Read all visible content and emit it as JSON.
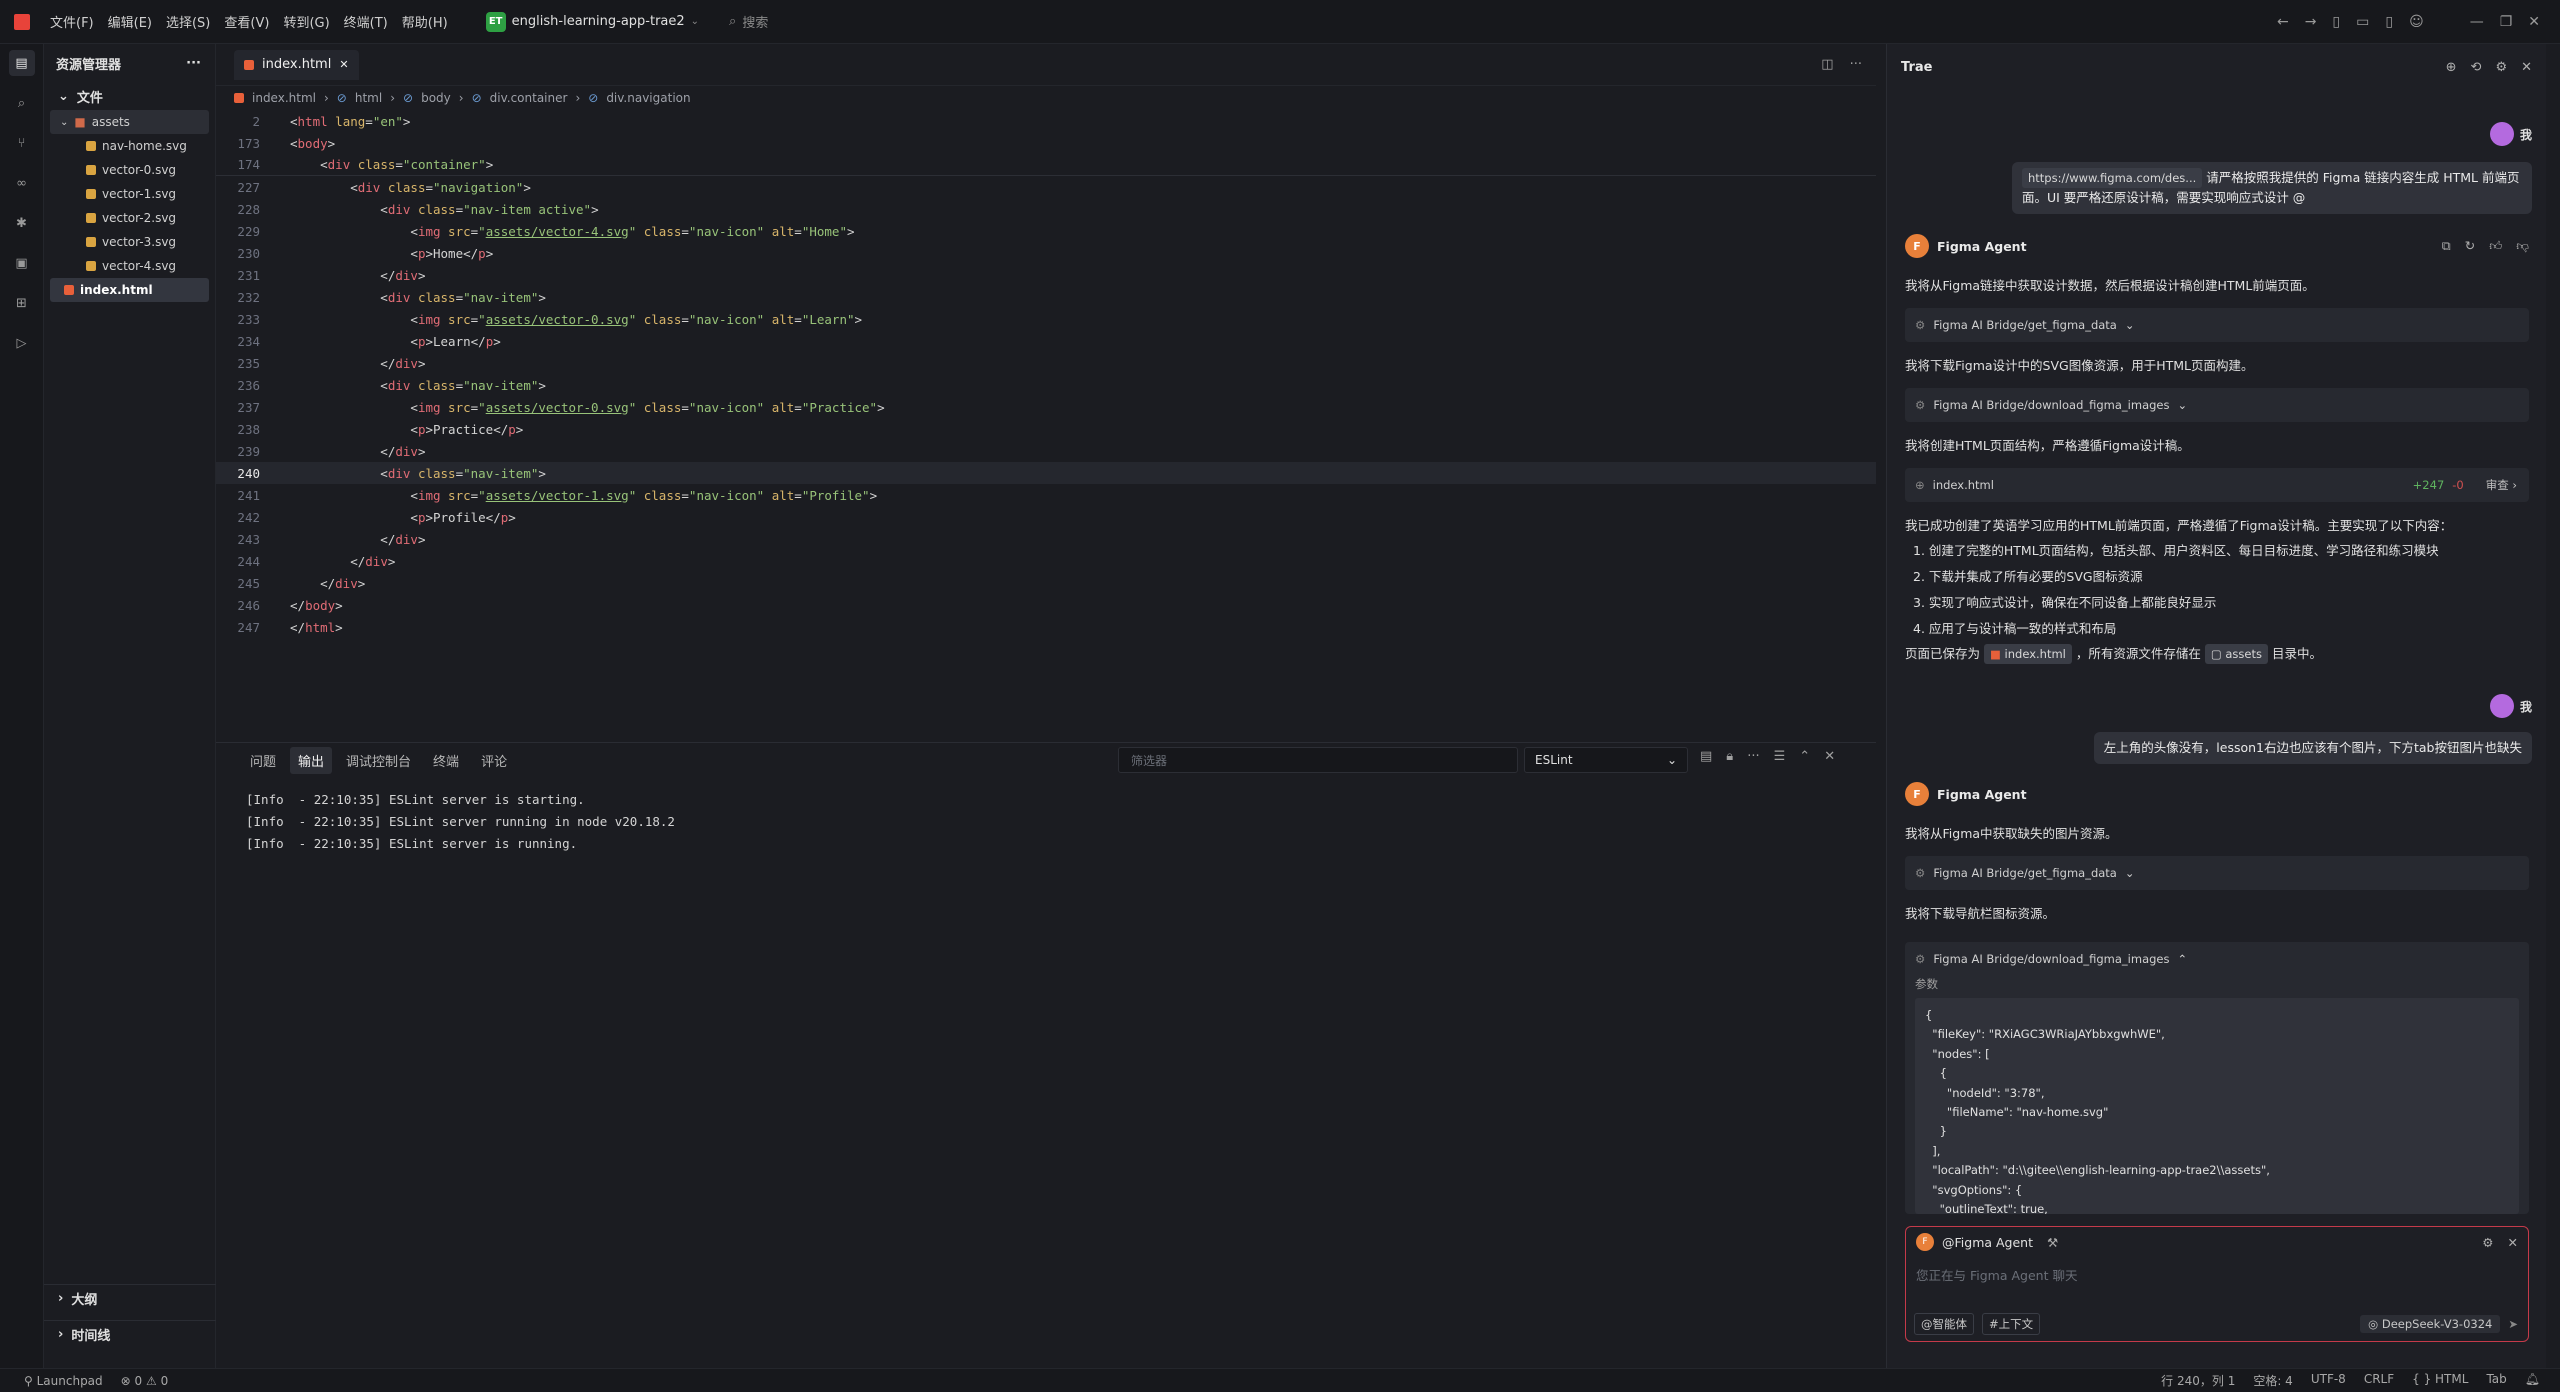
{
  "titlebar": {
    "menus": [
      "文件(F)",
      "编辑(E)",
      "选择(S)",
      "查看(V)",
      "转到(G)",
      "终端(T)",
      "帮助(H)"
    ],
    "project_badge": "ET",
    "project_name": "english-learning-app-trae2",
    "search_placeholder": "搜索"
  },
  "sidebar": {
    "title": "资源管理器",
    "section_files": "文件",
    "folder": "assets",
    "files": [
      "nav-home.svg",
      "vector-0.svg",
      "vector-1.svg",
      "vector-2.svg",
      "vector-3.svg",
      "vector-4.svg"
    ],
    "selected_file": "index.html",
    "outline": "大纲",
    "timeline": "时间线"
  },
  "editor": {
    "tab": "index.html",
    "breadcrumb": [
      "index.html",
      "html",
      "body",
      "div.container",
      "div.navigation"
    ],
    "current_line": "240"
  },
  "panel": {
    "tabs": [
      "问题",
      "输出",
      "调试控制台",
      "终端",
      "评论"
    ],
    "active_tab": "输出",
    "filter_placeholder": "筛选器",
    "select_value": "ESLint",
    "output": [
      "[Info  - 22:10:35] ESLint server is starting.",
      "[Info  - 22:10:35] ESLint server running in node v20.18.2",
      "[Info  - 22:10:35] ESLint server is running."
    ]
  },
  "chat": {
    "title": "Trae",
    "me_label": "我",
    "msg1_link": "https://www.figma.com/des...",
    "msg1_text_a": "请严格按照我提供的 Figma 链接内容生成 HTML 前端页",
    "msg1_text_b": "面。UI 要严格还原设计稿，需要实现响应式设计 @",
    "agent_name": "Figma Agent",
    "agent_initial": "F",
    "a1": "我将从Figma链接中获取设计数据，然后根据设计稿创建HTML前端页面。",
    "tool_get": "Figma AI Bridge/get_figma_data",
    "a2": "我将下载Figma设计中的SVG图像资源，用于HTML页面构建。",
    "tool_download": "Figma AI Bridge/download_figma_images",
    "a3": "我将创建HTML页面结构，严格遵循Figma设计稿。",
    "file_name": "index.html",
    "file_add": "+247",
    "file_del": "-0",
    "file_review": "审查",
    "a4": "我已成功创建了英语学习应用的HTML前端页面，严格遵循了Figma设计稿。主要实现了以下内容：",
    "points": [
      "1. 创建了完整的HTML页面结构，包括头部、用户资料区、每日目标进度、学习路径和练习模块",
      "2. 下载并集成了所有必要的SVG图标资源",
      "3. 实现了响应式设计，确保在不同设备上都能良好显示",
      "4. 应用了与设计稿一致的样式和布局"
    ],
    "a5_pre": "页面已保存为",
    "a5_file": "index.html",
    "a5_mid": "，所有资源文件存储在",
    "a5_dir": "assets",
    "a5_post": "目录中。",
    "msg2": "左上角的头像没有，lesson1右边也应该有个图片，下方tab按钮图片也缺失",
    "b1": "我将从Figma中获取缺失的图片资源。",
    "b2": "我将下载导航栏图标资源。",
    "params_label": "参数",
    "input_agent": "@Figma Agent",
    "input_placeholder": "您正在与 Figma Agent 聊天",
    "input_agent_btn": "@智能体",
    "input_context_btn": "#上下文",
    "model": "DeepSeek-V3-0324"
  },
  "statusbar": {
    "launchpad": "Launchpad",
    "errors": "0",
    "warnings": "0",
    "position": "行 240，列 1",
    "spaces": "空格: 4",
    "encoding": "UTF-8",
    "eol": "CRLF",
    "language": "HTML",
    "tab": "Tab"
  },
  "colors": {
    "accent_red": "#e8433a",
    "agent_orange": "#e8803a",
    "string_green": "#98c379",
    "tag_red": "#e06c75",
    "attr_yellow": "#d8b56a"
  }
}
